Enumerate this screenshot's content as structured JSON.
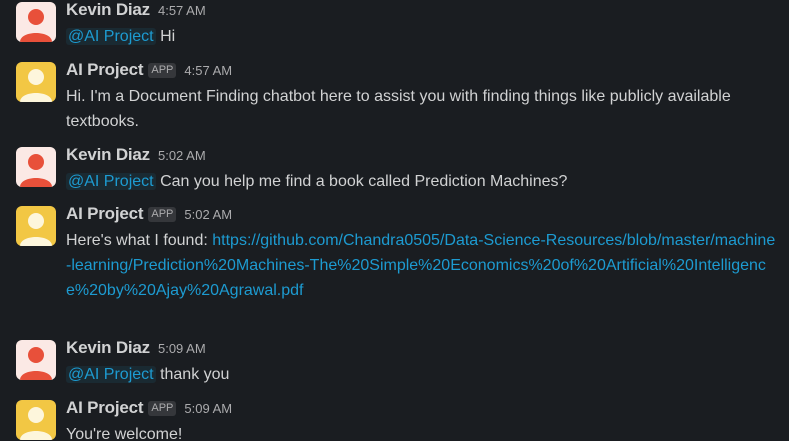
{
  "colors": {
    "background": "#1a1d21",
    "text": "#d1d2d3",
    "link": "#1d9bd1",
    "human_avatar": "#e8503a",
    "bot_avatar": "#f2c744"
  },
  "messages": [
    {
      "author": "Kevin Diaz",
      "is_app": false,
      "app_badge": "",
      "time": "4:57 AM",
      "mention": "@AI Project",
      "text": "Hi",
      "avatar_icon": "person-icon"
    },
    {
      "author": "AI Project",
      "is_app": true,
      "app_badge": "APP",
      "time": "4:57 AM",
      "text": "Hi. I'm a Document Finding chatbot here to assist you with finding things like publicly available textbooks.",
      "avatar_icon": "person-icon"
    },
    {
      "author": "Kevin Diaz",
      "is_app": false,
      "time": "5:02 AM",
      "mention": "@AI Project",
      "text": "Can you help me find a book called Prediction Machines?",
      "avatar_icon": "person-icon"
    },
    {
      "author": "AI Project",
      "is_app": true,
      "app_badge": "APP",
      "time": "5:02 AM",
      "text": "Here's what I found:",
      "link": "https://github.com/Chandra0505/Data-Science-Resources/blob/master/machine-learning/Prediction%20Machines-The%20Simple%20Economics%20of%20Artificial%20Intelligence%20by%20Ajay%20Agrawal.pdf",
      "avatar_icon": "person-icon"
    },
    {
      "author": "Kevin Diaz",
      "is_app": false,
      "time": "5:09 AM",
      "mention": "@AI Project",
      "text": "thank you",
      "avatar_icon": "person-icon"
    },
    {
      "author": "AI Project",
      "is_app": true,
      "app_badge": "APP",
      "time": "5:09 AM",
      "text": "You're welcome!",
      "avatar_icon": "person-icon"
    }
  ]
}
